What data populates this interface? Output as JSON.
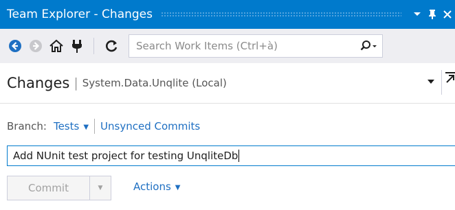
{
  "window": {
    "title": "Team Explorer - Changes",
    "buttons": [
      "dropdown",
      "pin",
      "close"
    ]
  },
  "toolbar": {
    "icons": [
      "back-icon",
      "forward-icon",
      "home-icon",
      "connect-icon",
      "refresh-icon"
    ],
    "search": {
      "placeholder": "Search Work Items (Ctrl+à)"
    }
  },
  "header": {
    "title": "Changes",
    "separator": "|",
    "context": "System.Data.Unqlite (Local)"
  },
  "branch": {
    "label": "Branch:",
    "name": "Tests",
    "link": "Unsynced Commits"
  },
  "commit_message": "Add NUnit test project for testing UnqliteDb",
  "actions_bar": {
    "commit_label": "Commit",
    "actions_label": "Actions"
  },
  "colors": {
    "accent": "#007acc",
    "link": "#1e6fc2",
    "toolbar_bg": "#eeeef2"
  }
}
